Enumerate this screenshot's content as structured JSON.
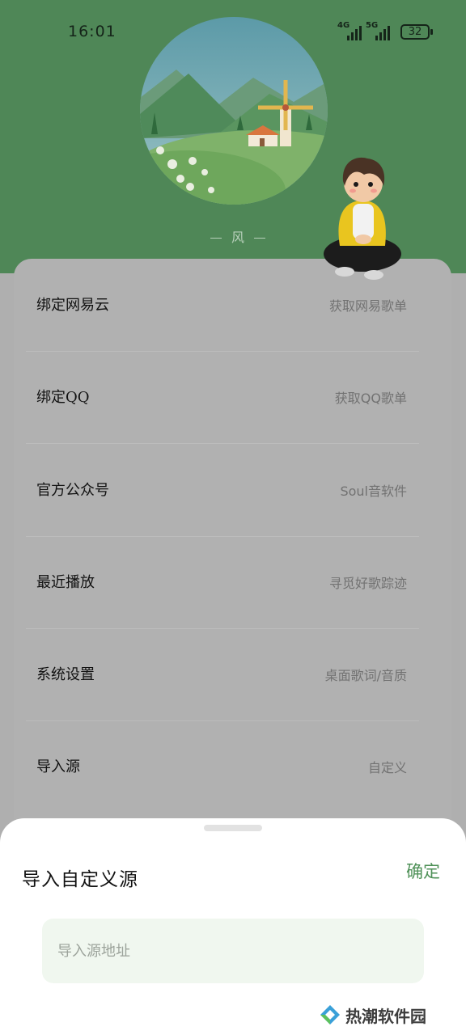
{
  "status_bar": {
    "time": "16:01",
    "network_1": "4G",
    "network_2": "5G",
    "battery": "32"
  },
  "profile": {
    "caption": "风"
  },
  "menu": {
    "items": [
      {
        "label": "绑定网易云",
        "hint": "获取网易歌单"
      },
      {
        "label": "绑定QQ",
        "hint": "获取QQ歌单"
      },
      {
        "label": "官方公众号",
        "hint": "Soul音软件"
      },
      {
        "label": "最近播放",
        "hint": "寻觅好歌踪迹"
      },
      {
        "label": "系统设置",
        "hint": "桌面歌词/音质"
      },
      {
        "label": "导入源",
        "hint": "自定义"
      }
    ]
  },
  "sheet": {
    "title": "导入自定义源",
    "confirm_label": "确定",
    "input_placeholder": "导入源地址",
    "input_value": ""
  },
  "watermark": {
    "text": "热潮软件园"
  },
  "colors": {
    "header_green": "#4f8757",
    "accent_green": "#4f9158",
    "input_bg": "#f0f7ef"
  }
}
